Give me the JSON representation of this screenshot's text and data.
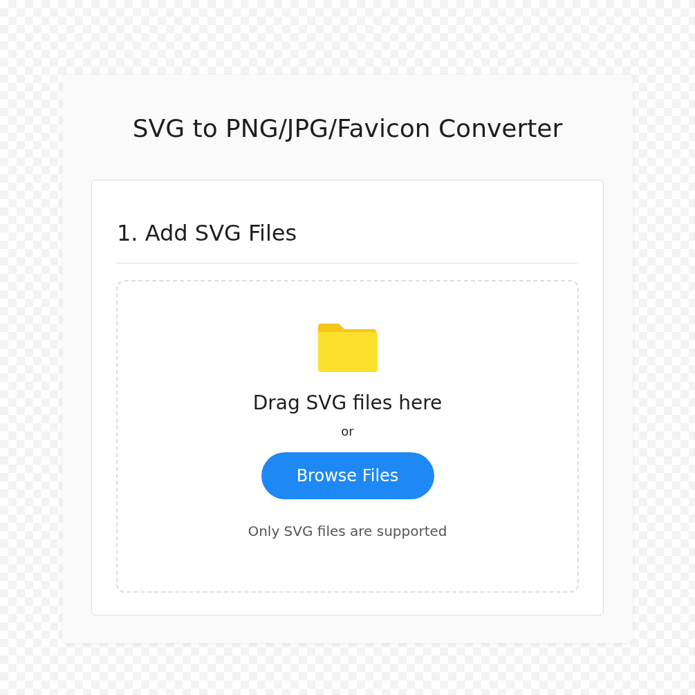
{
  "title": "SVG to PNG/JPG/Favicon Converter",
  "section": {
    "heading": "1. Add SVG Files",
    "dropzone": {
      "prompt": "Drag SVG files here",
      "separator": "or",
      "button": "Browse Files",
      "note": "Only SVG files are supported"
    }
  }
}
